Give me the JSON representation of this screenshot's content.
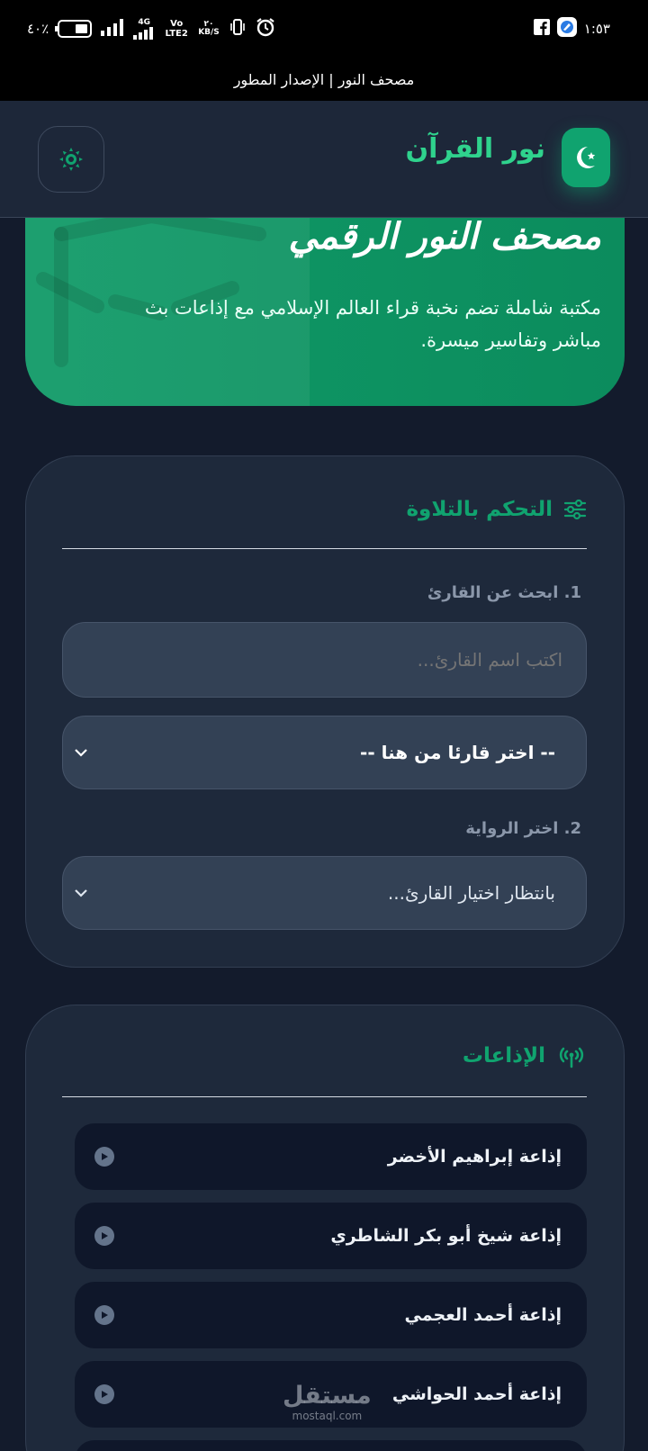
{
  "status_bar": {
    "battery": "٤٠٪",
    "network": "4G",
    "volte": "Vo LTE2",
    "speed_value": "٢٠",
    "speed_unit": "KB/S",
    "time": "١:٥٣"
  },
  "window_title": "مصحف النور | الإصدار المطور",
  "header": {
    "brand_name": "نور القرآن",
    "logo_icon": "crescent-star-icon",
    "theme_icon": "sun-icon"
  },
  "hero": {
    "title": "مصحف النور الرقمي",
    "description": "مكتبة شاملة تضم نخبة قراء العالم الإسلامي مع إذاعات بث مباشر وتفاسير ميسرة."
  },
  "recitation_panel": {
    "title": "التحكم بالتلاوة",
    "icon": "sliders-icon",
    "search_label": "1. ابحث عن القارئ",
    "search_placeholder": "اكتب اسم القارئ...",
    "reciter_select": "-- اختر قارئا من هنا --",
    "narration_label": "2. اختر الرواية",
    "narration_select": "بانتظار اختيار القارئ..."
  },
  "radios_panel": {
    "title": "الإذاعات",
    "icon": "broadcast-icon",
    "items": [
      {
        "label": "إذاعة إبراهيم الأخضر"
      },
      {
        "label": "إذاعة شيخ أبو بكر الشاطري"
      },
      {
        "label": "إذاعة أحمد العجمي"
      },
      {
        "label": "إذاعة أحمد الحواشي"
      }
    ]
  },
  "watermark": {
    "arabic": "مستقل",
    "latin": "mostaql.com"
  },
  "colors": {
    "accent": "#10a36f",
    "background": "#131b2c",
    "card": "#1e293b",
    "input": "#334155"
  }
}
